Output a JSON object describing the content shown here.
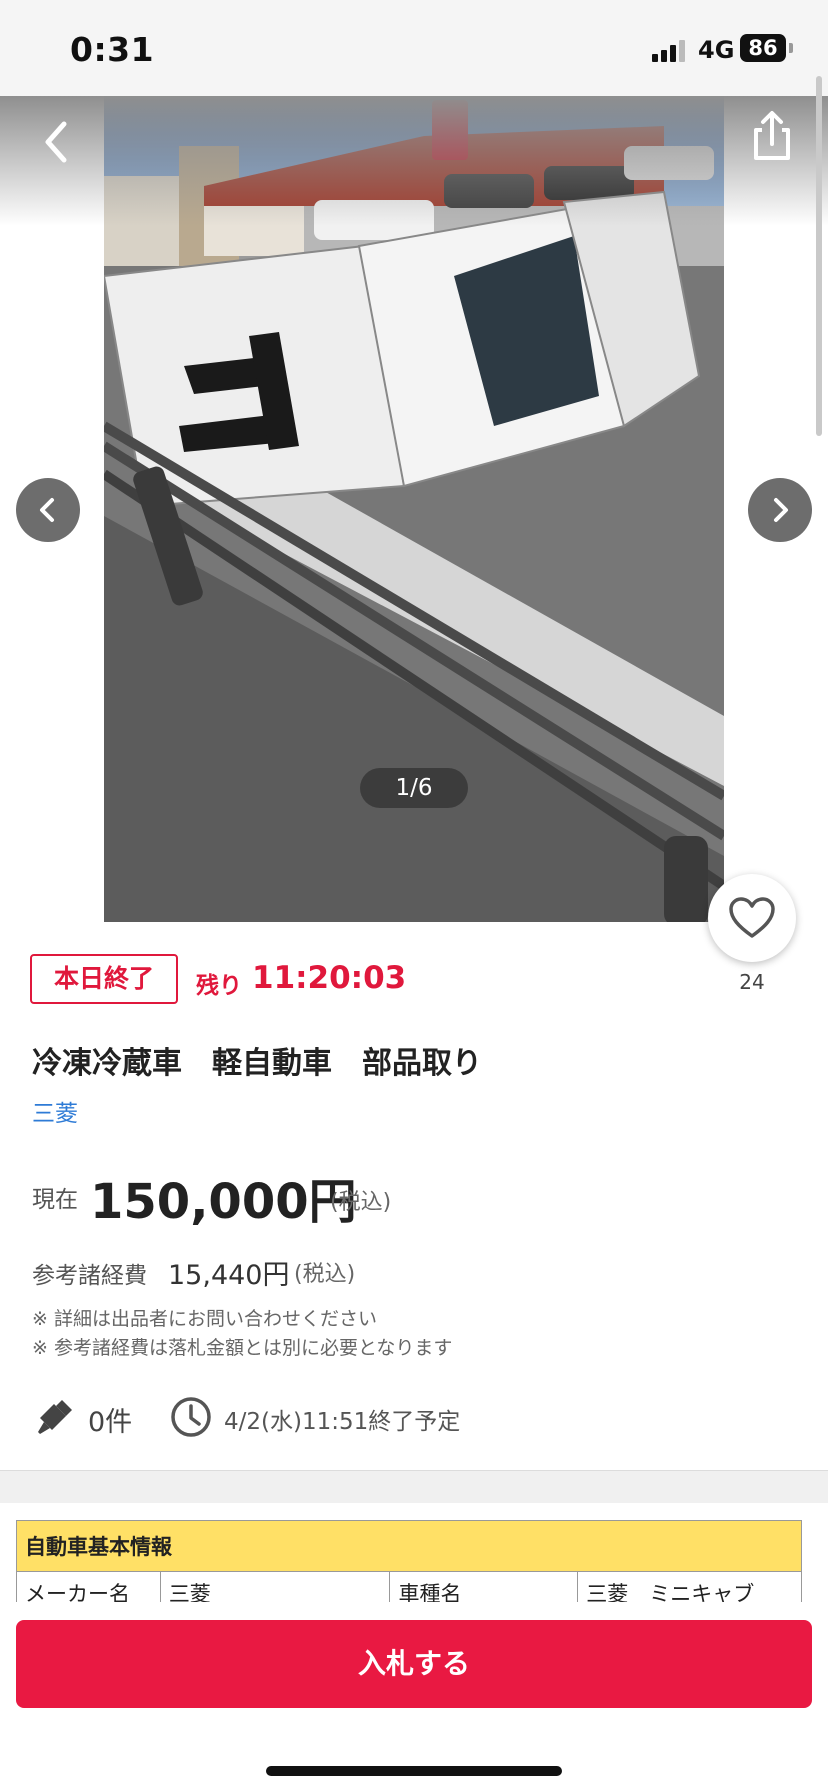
{
  "status_bar": {
    "time": "0:31",
    "network": "4G",
    "battery": "86"
  },
  "gallery": {
    "counter": "1/6",
    "favorite_count": "24"
  },
  "auction": {
    "end_badge": "本日終了",
    "remaining_label": "残り",
    "remaining_time": "11:20:03",
    "title": "冷凍冷蔵車　軽自動車　部品取り",
    "brand": "三菱",
    "price_label": "現在",
    "price": "150,000円",
    "price_tax": "(税込)",
    "fee_label": "参考諸経費",
    "fee_value": "15,440円",
    "fee_tax": "(税込)",
    "note1": "※ 詳細は出品者にお問い合わせください",
    "note2": "※ 参考諸経費は落札金額とは別に必要となります",
    "bid_count": "0件",
    "end_date": "4/2(水)11:51終了予定"
  },
  "vehicle_table": {
    "heading": "自動車基本情報",
    "rows": [
      [
        "メーカー名",
        "三菱",
        "車種名",
        "三菱　ミニキャブ"
      ]
    ]
  },
  "bottom": {
    "bid_button": "入札する"
  },
  "colors": {
    "accent_red": "#e91942",
    "link_blue": "#2e7bd6",
    "table_header": "#ffe066"
  }
}
